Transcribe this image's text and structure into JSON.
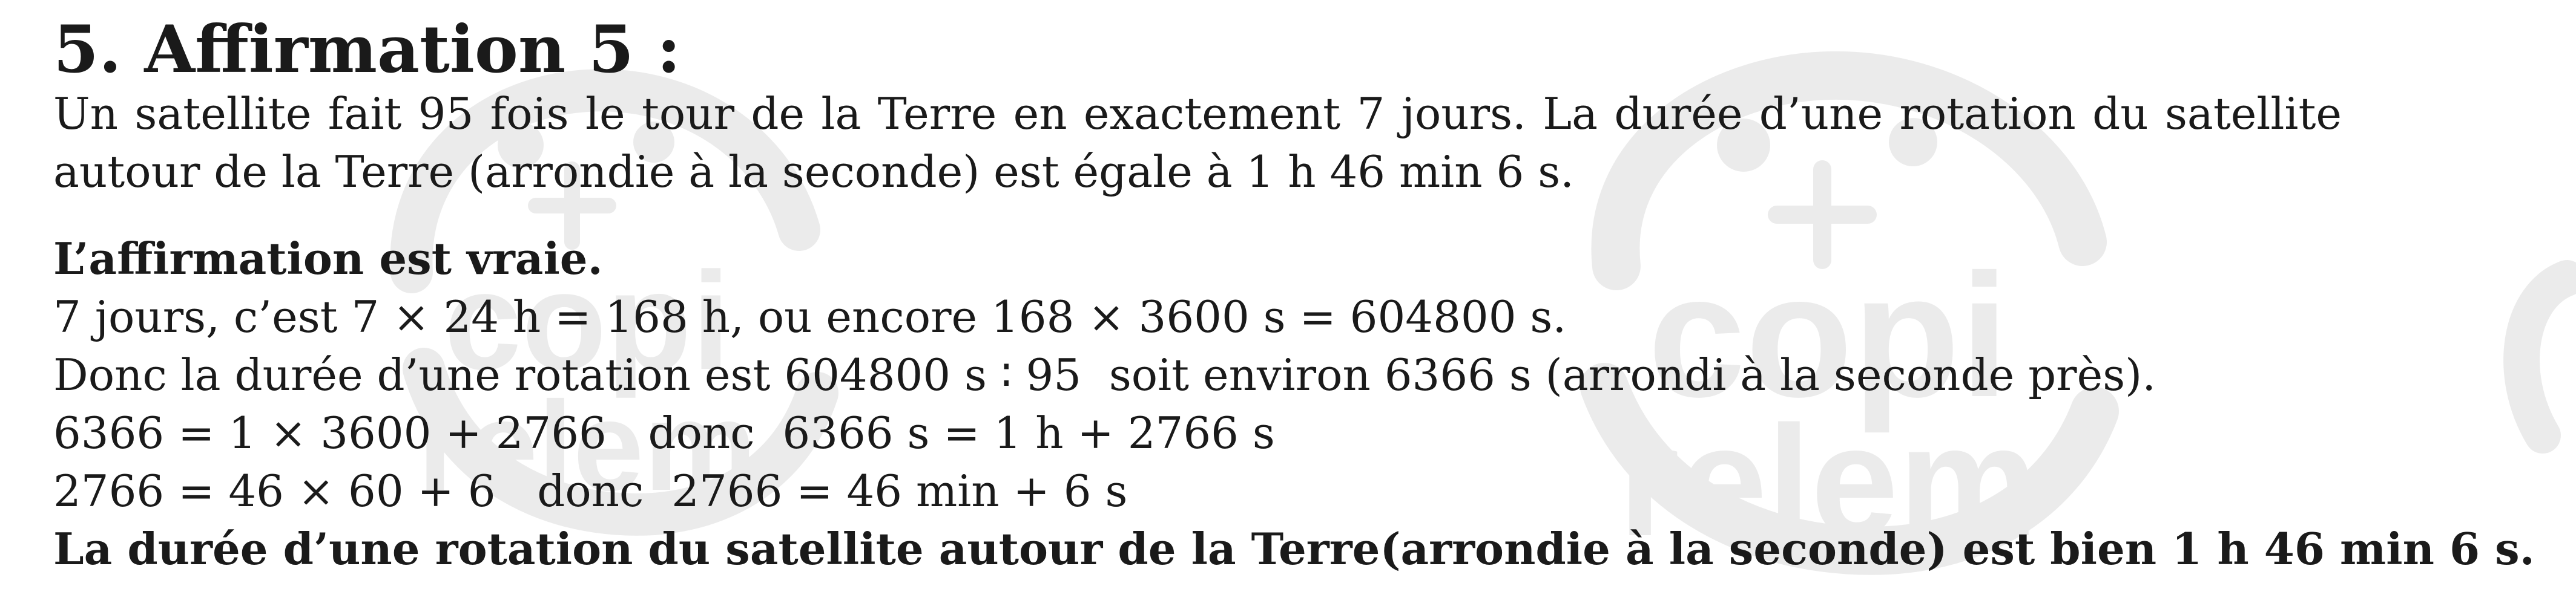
{
  "document": {
    "title": "5. Affirmation 5 :",
    "statement": {
      "line1": "Un satellite fait 95 fois le tour de la Terre en exactement 7 jours. La durée d’une rotation du satellite",
      "line2": "autour de la Terre (arrondie à la seconde) est égale à 1 h 46 min 6 s."
    },
    "answer_heading": "L’affirmation est vraie.",
    "solution_lines": [
      "7 jours, c’est 7 × 24 h = 168 h, ou encore 168 × 3600 s = 604800 s.",
      "Donc la durée d’une rotation est 604800 s ∶ 95  soit environ 6366 s (arrondi à la seconde près).",
      "6366 = 1 × 3600 + 2766   donc  6366 s = 1 h + 2766 s",
      "2766 = 46 × 60 + 6   donc  2766 = 46 min + 6 s"
    ],
    "conclusion": "La durée d’une rotation du satellite autour de la Terre(arrondie à la seconde) est bien 1 h 46 min 6 s."
  },
  "watermark": {
    "text_line1": "copi",
    "text_line2": "relem",
    "color": "#000000"
  }
}
